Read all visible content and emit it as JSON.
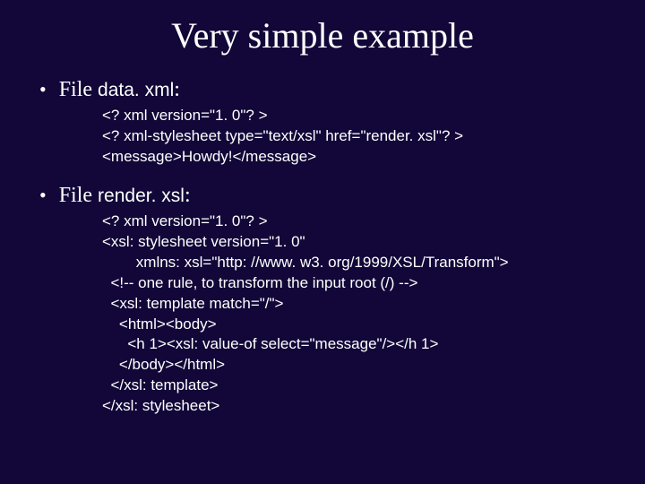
{
  "title": "Very simple example",
  "bullets": {
    "b1_prefix": "File ",
    "b1_file": "data. xml",
    "b1_suffix": ":",
    "b2_prefix": "File ",
    "b2_file": "render. xsl",
    "b2_suffix": ":"
  },
  "code1": "<? xml version=\"1. 0\"? >\n<? xml-stylesheet type=\"text/xsl\" href=\"render. xsl\"? >\n<message>Howdy!</message>",
  "code2": "<? xml version=\"1. 0\"? >\n<xsl: stylesheet version=\"1. 0\"\n        xmlns: xsl=\"http: //www. w3. org/1999/XSL/Transform\">\n  <!-- one rule, to transform the input root (/) -->\n  <xsl: template match=\"/\">\n    <html><body>\n      <h 1><xsl: value-of select=\"message\"/></h 1>\n    </body></html>\n  </xsl: template>\n</xsl: stylesheet>"
}
